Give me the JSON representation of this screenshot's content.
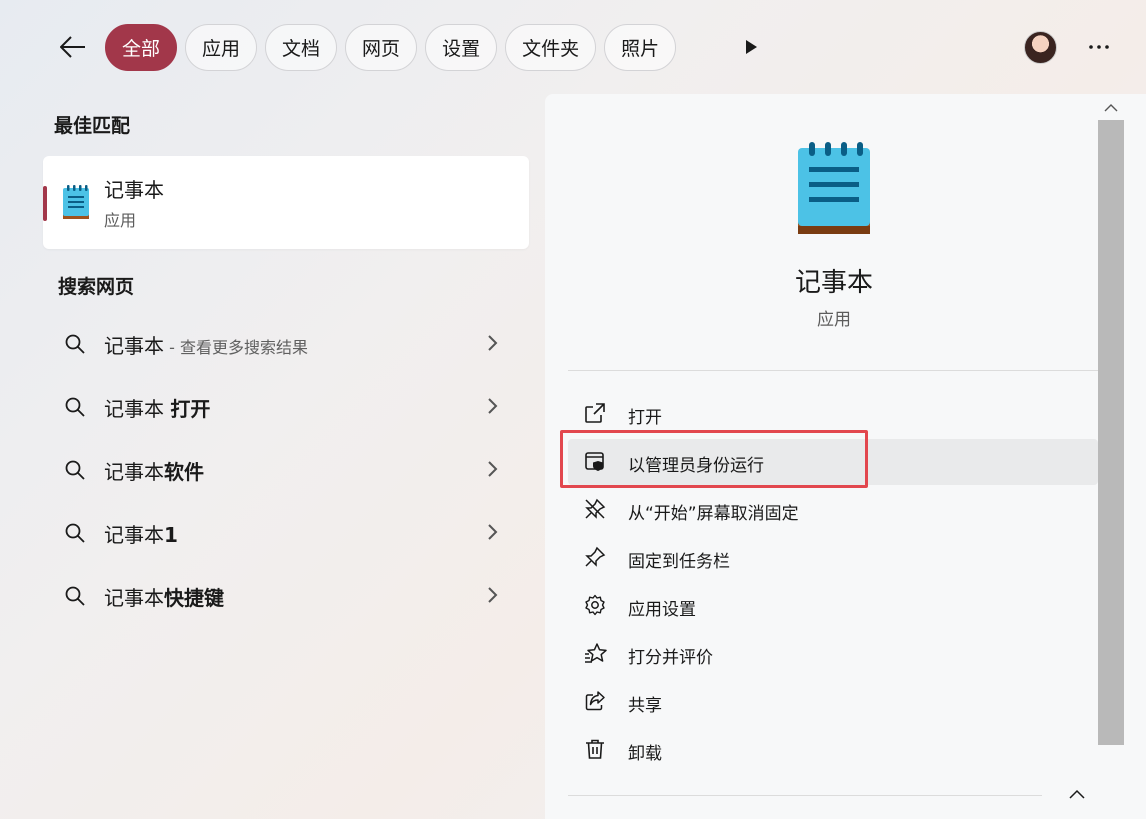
{
  "filters": {
    "tabs": [
      "全部",
      "应用",
      "文档",
      "网页",
      "设置",
      "文件夹",
      "照片"
    ],
    "active_index": 0
  },
  "best_match": {
    "heading": "最佳匹配",
    "title": "记事本",
    "subtitle": "应用"
  },
  "web_search": {
    "heading": "搜索网页",
    "items": [
      {
        "base": "记事本",
        "bold": "",
        "hint": " - 查看更多搜索结果"
      },
      {
        "base": "记事本 ",
        "bold": "打开",
        "hint": ""
      },
      {
        "base": "记事本",
        "bold": "软件",
        "hint": ""
      },
      {
        "base": "记事本",
        "bold": "1",
        "hint": ""
      },
      {
        "base": "记事本",
        "bold": "快捷键",
        "hint": ""
      }
    ]
  },
  "detail": {
    "app_name": "记事本",
    "app_type": "应用",
    "actions": [
      {
        "label": "打开",
        "icon": "open-external-icon"
      },
      {
        "label": "以管理员身份运行",
        "icon": "run-as-admin-icon"
      },
      {
        "label": "从“开始”屏幕取消固定",
        "icon": "unpin-icon"
      },
      {
        "label": "固定到任务栏",
        "icon": "pin-icon"
      },
      {
        "label": "应用设置",
        "icon": "gear-icon"
      },
      {
        "label": "打分并评价",
        "icon": "rate-star-icon"
      },
      {
        "label": "共享",
        "icon": "share-icon"
      },
      {
        "label": "卸载",
        "icon": "trash-icon"
      }
    ],
    "highlighted_action_index": 1
  },
  "colors": {
    "accent": "#a2374a",
    "highlight_border": "#e2474e",
    "notepad_blue": "#4cc2e6",
    "notepad_brown": "#a0521e"
  }
}
